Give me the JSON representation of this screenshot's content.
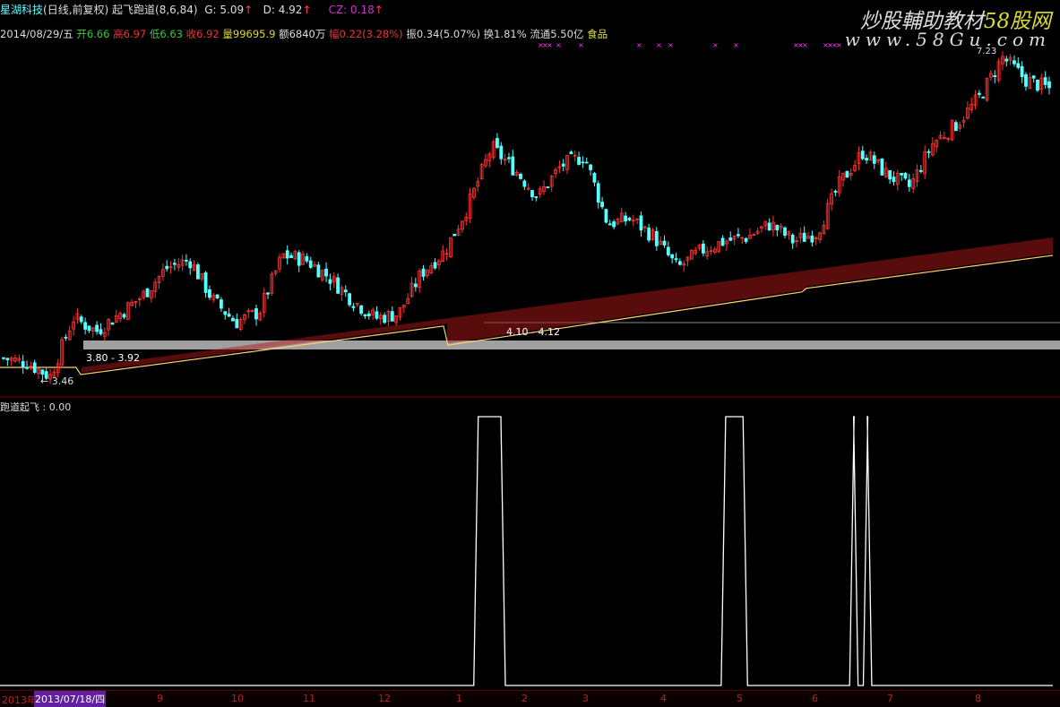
{
  "header": {
    "stock": "星湖科技",
    "mode": "(日线,前复权)",
    "indicator": "起飞跑道(8,6,84)",
    "g_label": "G: 5.09",
    "d_label": "D: 4.92",
    "cz_label": "CZ: 0.18",
    "arrow": "↑"
  },
  "info": {
    "date": "2014/08/29/五",
    "open": "开6.66",
    "high": "高6.97",
    "low": "低6.63",
    "close": "收6.92",
    "volume": "量99695.9",
    "amount": "额6840万",
    "change": "幅0.22(3.28%)",
    "amplitude": "振0.34(5.07%)",
    "turnover": "换1.81%",
    "float": "流通5.50亿",
    "sector": "食品"
  },
  "watermark": {
    "line1": "炒股輔助教材",
    "line1_accent": "58股网",
    "line2": "www.58Gu.com"
  },
  "annotations": {
    "max": "7.23",
    "min": "← 3.46",
    "zone1": "3.80 - 3.92",
    "zone2": "4.10 - 4.12"
  },
  "lower_pane": {
    "label": "跑道起飞 : 0.00"
  },
  "axis": {
    "year": "2013年",
    "cursor_date": "2013/07/18/四",
    "months": [
      "9",
      "10",
      "11",
      "12",
      "1",
      "2",
      "3",
      "4",
      "5",
      "6",
      "7",
      "8"
    ]
  },
  "colors": {
    "up": "#ff3333",
    "down": "#54ffff",
    "ma": "#ffd070",
    "band": "#b01818",
    "signal": "#ffffff",
    "marks": "#ff33ff",
    "zone": "#a0a0a0"
  },
  "chart_data": {
    "type": "candlestick",
    "close_path": [
      3.72,
      3.67,
      3.51,
      4.18,
      4.03,
      4.23,
      4.44,
      4.75,
      4.85,
      4.39,
      4.13,
      4.25,
      4.9,
      4.85,
      4.65,
      4.39,
      4.18,
      4.23,
      4.7,
      4.95,
      5.47,
      6.14,
      5.88,
      5.57,
      5.93,
      6.04,
      5.26,
      5.32,
      5.11,
      4.75,
      4.95,
      5.06,
      5.11,
      5.26,
      5.06,
      5.16,
      5.73,
      6.09,
      5.83,
      5.68,
      6.19,
      6.4,
      6.71,
      7.17,
      6.91,
      6.81
    ],
    "price_range": [
      3.46,
      7.23
    ],
    "signal_periods": [
      [
        0.45,
        0.48
      ],
      [
        0.685,
        0.71
      ],
      [
        0.807,
        0.815
      ],
      [
        0.82,
        0.828
      ]
    ],
    "signal_range": [
      0,
      1
    ]
  }
}
